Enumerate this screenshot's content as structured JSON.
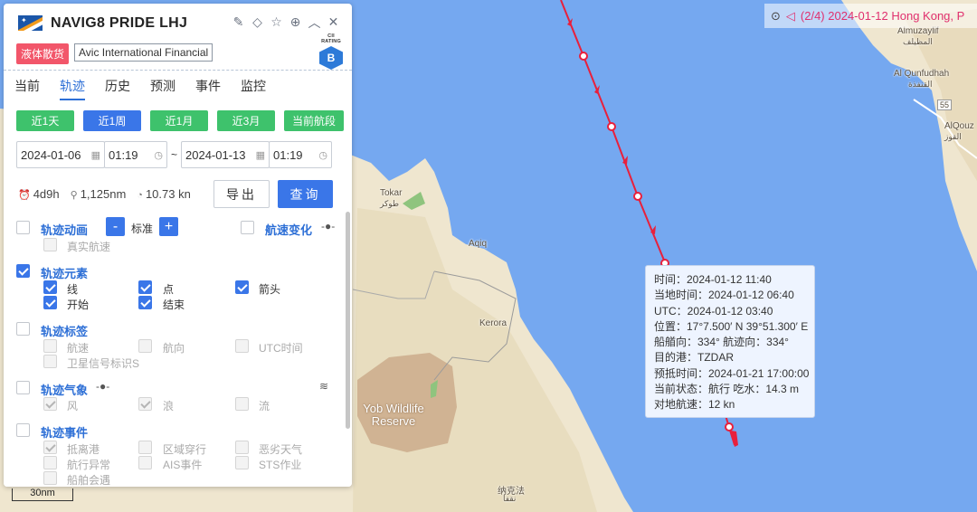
{
  "vessel": {
    "name": "NAVIG8 PRIDE LHJ",
    "type_tag": "液体散货",
    "owner_tag": "Avic International Financial",
    "cii_label": "CII RATING",
    "cii_grade": "B",
    "tag_color": "#f2566a"
  },
  "header_icons": [
    "edit-icon",
    "tag-icon",
    "star-icon",
    "target-icon",
    "collapse-icon",
    "close-icon"
  ],
  "tabs": [
    {
      "label": "当前"
    },
    {
      "label": "轨迹",
      "active": true
    },
    {
      "label": "历史"
    },
    {
      "label": "预测"
    },
    {
      "label": "事件"
    },
    {
      "label": "监控"
    }
  ],
  "quick_range": [
    {
      "label": "近1天"
    },
    {
      "label": "近1周",
      "selected": true
    },
    {
      "label": "近1月"
    },
    {
      "label": "近3月"
    },
    {
      "label": "当前航段"
    }
  ],
  "range": {
    "start_date": "2024-01-06",
    "start_time": "01:19",
    "separator": "~",
    "end_date": "2024-01-13",
    "end_time": "01:19"
  },
  "stats": {
    "duration": "4d9h",
    "distance": "1,125nm",
    "speed": "10.73 kn"
  },
  "actions": {
    "export": "导出",
    "query": "查询"
  },
  "sections": {
    "animation": {
      "title": "轨迹动画",
      "minus": "-",
      "speed_label": "标准",
      "plus": "+",
      "real_speed": "真实航速"
    },
    "speed_change": {
      "title": "航速变化"
    },
    "elements": {
      "title": "轨迹元素",
      "items": [
        "线",
        "点",
        "箭头",
        "开始",
        "结束"
      ]
    },
    "labels": {
      "title": "轨迹标签",
      "items": [
        "航速",
        "航向",
        "UTC时间",
        "卫星信号标识S"
      ]
    },
    "weather": {
      "title": "轨迹气象",
      "items": [
        "风",
        "浪",
        "流"
      ]
    },
    "events": {
      "title": "轨迹事件",
      "items": [
        "抵离港",
        "区域穿行",
        "恶劣天气",
        "航行异常",
        "AIS事件",
        "STS作业",
        "船舶会遇"
      ]
    }
  },
  "topbar": {
    "text": "(2/4) 2024-01-12 Hong Kong, P"
  },
  "tooltip": {
    "time": "时间：2024-01-12 11:40",
    "local": "当地时间：2024-01-12 06:40",
    "utc": "UTC：2024-01-12 03:40",
    "position": "位置：17°7.500′ N  39°51.300′ E",
    "heading": "船艏向：334°   航迹向：334°",
    "dest": "目的港：TZDAR",
    "eta": "预抵时间：2024-01-21 17:00:00",
    "status": "当前状态：航行   吃水：14.3 m",
    "sog": "对地航速：12 kn"
  },
  "map": {
    "labels": {
      "tokar": "Tokar",
      "tokar_ar": "طوكر",
      "aqiq": "Aqiq",
      "kerora": "Kerora",
      "reserve": "Yob Wildlife Reserve",
      "nakfa": "纳克法",
      "nakfa_ar": "نقفا",
      "almuzaylif": "Almuzaylif",
      "almuzaylif_ar": "المظيلف",
      "alqunfudhah": "Al Qunfudhah",
      "alqunfudhah_ar": "القنفذة",
      "road": "55",
      "alqouz": "AlQouz",
      "alqouz_ar": "القوز"
    },
    "scale": "30nm",
    "track_color": "#e8203c",
    "sea_color": "#75a8f0"
  }
}
